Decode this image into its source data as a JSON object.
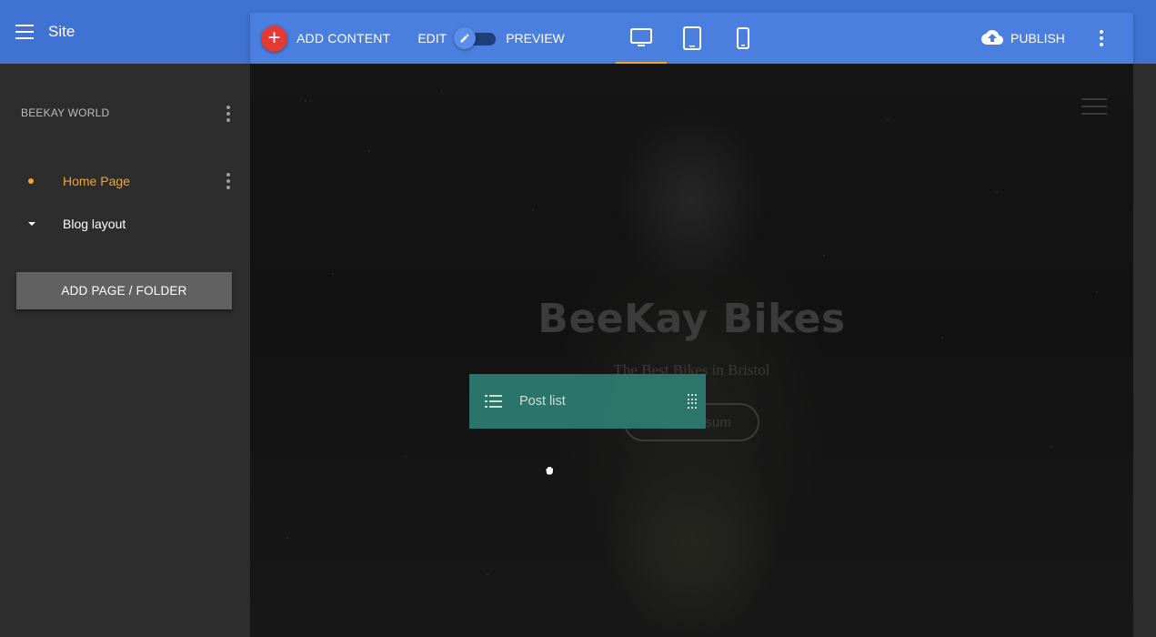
{
  "sidebar_header": {
    "title": "Site"
  },
  "toolbar": {
    "add_content_label": "ADD CONTENT",
    "edit_label": "EDIT",
    "preview_label": "PREVIEW",
    "publish_label": "PUBLISH",
    "devices": [
      "desktop-icon",
      "tablet-icon",
      "phone-icon"
    ],
    "active_device": "desktop"
  },
  "sidebar": {
    "site_name": "BEEKAY WORLD",
    "pages": [
      {
        "label": "Home Page",
        "active": true
      },
      {
        "label": "Blog layout",
        "active": false
      }
    ],
    "add_page_label": "ADD PAGE / FOLDER"
  },
  "preview": {
    "hero_title": "BeeKay Bikes",
    "hero_subtitle": "The Best Bikes in Bristol",
    "hero_button": "Lorem ipsum"
  },
  "drag_item": {
    "label": "Post list",
    "icon": "list-icon"
  },
  "colors": {
    "primary": "#3f72d2",
    "toolbar": "#4a7fe0",
    "accent": "#f0a52f",
    "add_button": "#e53935",
    "drag_chip": "#2d7a6e",
    "sidebar_bg": "#2d2d2d"
  }
}
